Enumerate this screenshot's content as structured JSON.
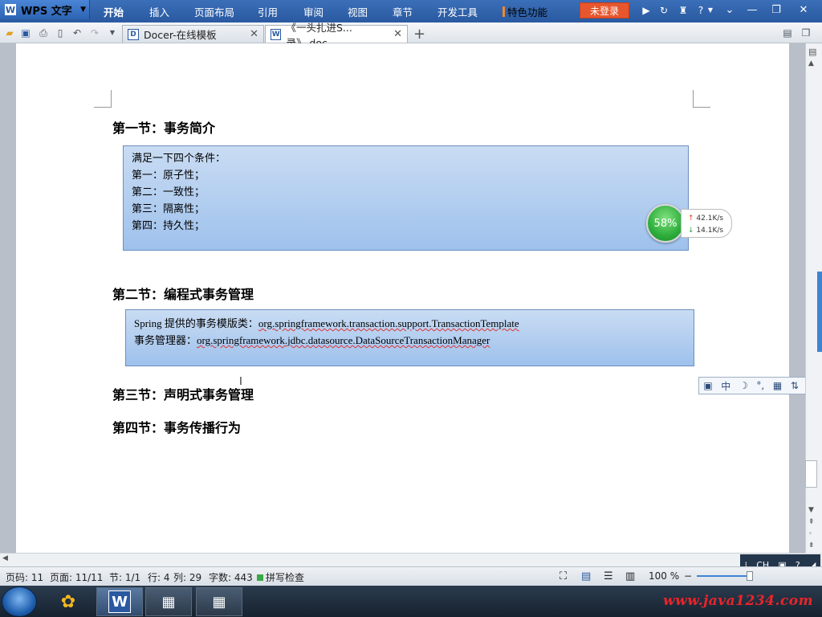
{
  "app": {
    "name": "WPS 文字",
    "menu": [
      "开始",
      "插入",
      "页面布局",
      "引用",
      "审阅",
      "视图",
      "章节",
      "开发工具"
    ],
    "tese": "特色功能",
    "login": "未登录"
  },
  "tabs": [
    {
      "icon": "D",
      "label": "Docer-在线模板"
    },
    {
      "icon": "W",
      "label": "《一头扎进S...录》.doc"
    }
  ],
  "document": {
    "h1": "第一节：事务简介",
    "box1": [
      "满足一下四个条件：",
      "第一：原子性；",
      "第二：一致性；",
      "第三：隔离性；",
      "第四：持久性；"
    ],
    "h2": "第二节：编程式事务管理",
    "box2": {
      "line1_prefix": "Spring 提供的事务模版类：",
      "line1_value": "org.springframework.transaction.support.TransactionTemplate",
      "line2_prefix": "事务管理器：",
      "line2_value": "org.springframework.jdbc.datasource.DataSourceTransactionManager"
    },
    "h3": "第三节：声明式事务管理",
    "h4": "第四节：事务传播行为"
  },
  "speed": {
    "percent": "58%",
    "up": "42.1K/s",
    "down": "14.1K/s"
  },
  "ime": {
    "lang": "中"
  },
  "status": {
    "page_code": "页码: 11",
    "pages": "页面: 11/11",
    "section": "节: 1/1",
    "row": "行: 4",
    "col": "列: 29",
    "words": "字数: 443",
    "spell": "拼写检查",
    "zoom": "100 %"
  },
  "tray": {
    "lang": "CH"
  },
  "watermark": "www.java1234.com",
  "colors": {
    "menubar": "#2a59a0",
    "login": "#e8562d",
    "box": "#a9c8ee",
    "watermark": "#e8252a"
  }
}
